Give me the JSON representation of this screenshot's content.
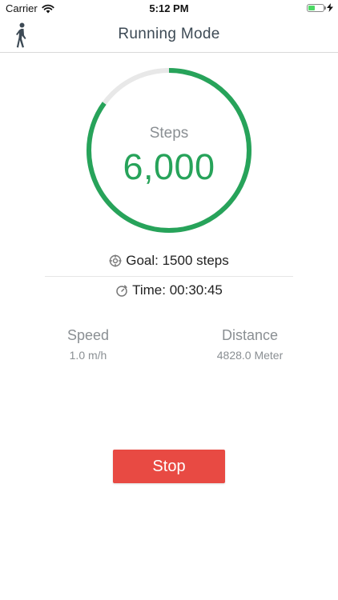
{
  "status_bar": {
    "carrier": "Carrier",
    "time": "5:12 PM",
    "icons": [
      "wifi-icon",
      "battery-icon",
      "charging-bolt-icon"
    ]
  },
  "nav": {
    "title": "Running Mode",
    "left_icon": "walking-person-icon"
  },
  "steps": {
    "label": "Steps",
    "value": "6,000",
    "ring_progress": 0.85,
    "ring_color": "#27a35a",
    "track_color": "#e8e8e8"
  },
  "goal": {
    "icon": "target-icon",
    "text": "Goal: 1500 steps"
  },
  "time": {
    "icon": "stopwatch-icon",
    "text": "Time: 00:30:45"
  },
  "stats": {
    "speed": {
      "label": "Speed",
      "value": "1.0 m/h"
    },
    "distance": {
      "label": "Distance",
      "value": "4828.0 Meter"
    }
  },
  "actions": {
    "stop_label": "Stop",
    "stop_color": "#e84a43"
  }
}
